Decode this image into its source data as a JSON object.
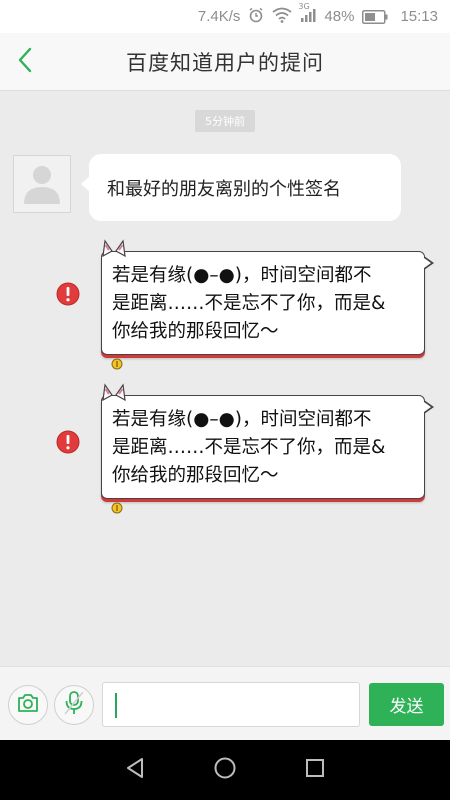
{
  "status_bar": {
    "net_speed": "7.4K/s",
    "network_type": "3G",
    "battery_pct": "48%",
    "time": "15:13",
    "icons": [
      "alarm-icon",
      "wifi-icon",
      "signal-icon",
      "battery-icon"
    ]
  },
  "header": {
    "title": "百度知道用户的提问",
    "back_icon": "chevron-left-icon",
    "accent": "#2eb157"
  },
  "chat": {
    "timestamp": "5分钟前",
    "incoming": {
      "text": "和最好的朋友离别的个性签名",
      "avatar_icon": "default-avatar-icon"
    },
    "outgoing": [
      {
        "text": "若是有缘(●–●)，时间空间都不\n是距离……不是忘不了你，而是&\n你给我的那段回忆～",
        "status_icon": "send-failed-icon",
        "status_color": "#e23b3b"
      },
      {
        "text": "若是有缘(●–●)，时间空间都不\n是距离……不是忘不了你，而是&\n你给我的那段回忆～",
        "status_icon": "send-failed-icon",
        "status_color": "#e23b3b"
      }
    ]
  },
  "input_bar": {
    "camera_icon": "camera-icon",
    "voice_icon": "microphone-icon",
    "input_value": "",
    "send_label": "发送"
  },
  "nav_bar": {
    "icons": [
      "back-triangle-icon",
      "home-circle-icon",
      "recents-square-icon"
    ]
  }
}
